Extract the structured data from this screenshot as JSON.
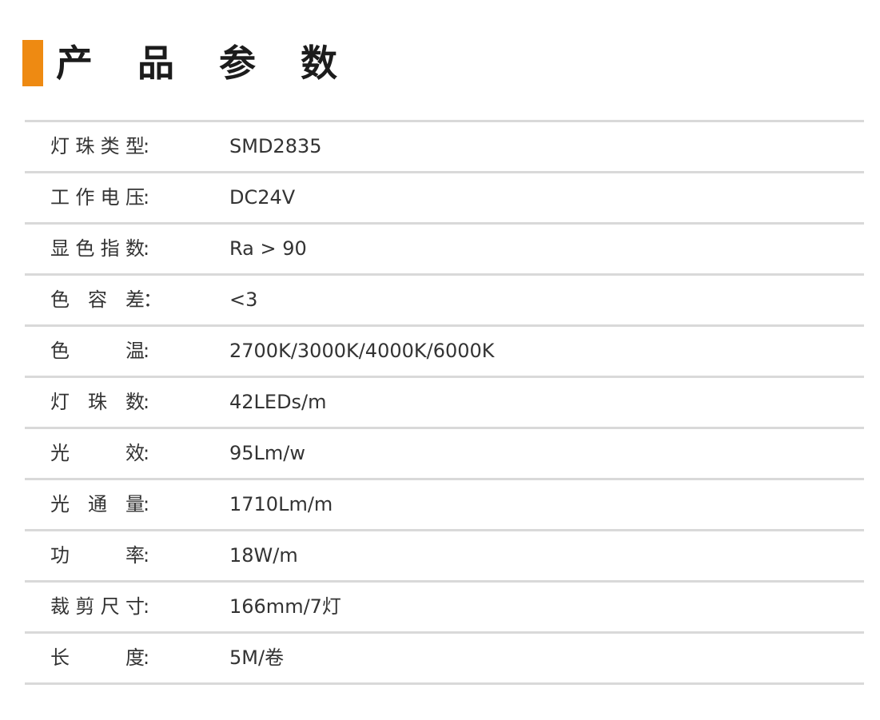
{
  "header": {
    "title": "产 品 参 数"
  },
  "specs": [
    {
      "label": "灯珠类型",
      "colon": ":",
      "value": "SMD2835"
    },
    {
      "label": "工作电压",
      "colon": ":",
      "value": "DC24V"
    },
    {
      "label": "显色指数",
      "colon": ":",
      "value": "Ra > 90"
    },
    {
      "label": "色容差",
      "colon": "：",
      "value": "<3"
    },
    {
      "label": "色温",
      "colon": ":",
      "value": "2700K/3000K/4000K/6000K"
    },
    {
      "label": "灯珠数",
      "colon": ":",
      "value": "42LEDs/m"
    },
    {
      "label": "光效",
      "colon": ":",
      "value": "95Lm/w"
    },
    {
      "label": "光通量",
      "colon": ":",
      "value": "1710Lm/m"
    },
    {
      "label": "功率",
      "colon": ":",
      "value": "18W/m"
    },
    {
      "label": "裁剪尺寸",
      "colon": ":",
      "value": "166mm/7灯"
    },
    {
      "label": "长度",
      "colon": ":",
      "value": "5M/卷"
    }
  ],
  "colors": {
    "accent": "#ee8a12",
    "title_text": "#1c1c1c",
    "body_text": "#333333",
    "rule": "#d9d9d9"
  }
}
